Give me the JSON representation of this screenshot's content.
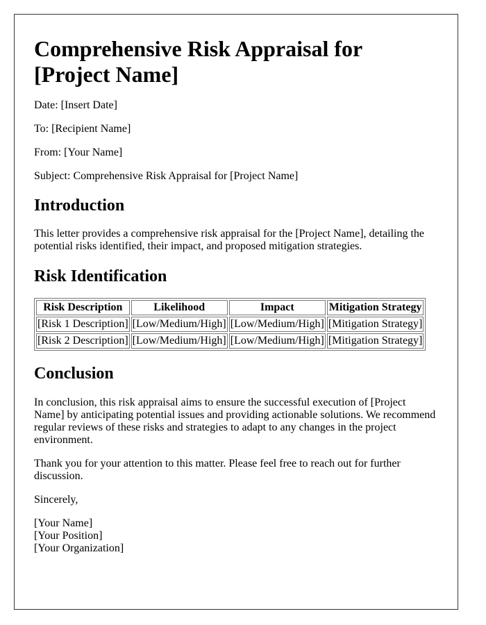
{
  "letter": {
    "title": "Comprehensive Risk Appraisal for [Project Name]",
    "meta": {
      "date": "Date: [Insert Date]",
      "to": "To: [Recipient Name]",
      "from": "From: [Your Name]",
      "subject": "Subject: Comprehensive Risk Appraisal for [Project Name]"
    },
    "introduction": {
      "heading": "Introduction",
      "text": "This letter provides a comprehensive risk appraisal for the [Project Name], detailing the potential risks identified, their impact, and proposed mitigation strategies."
    },
    "risk_identification": {
      "heading": "Risk Identification",
      "table": {
        "headers": [
          "Risk Description",
          "Likelihood",
          "Impact",
          "Mitigation Strategy"
        ],
        "rows": [
          [
            "[Risk 1 Description]",
            "[Low/Medium/High]",
            "[Low/Medium/High]",
            "[Mitigation Strategy]"
          ],
          [
            "[Risk 2 Description]",
            "[Low/Medium/High]",
            "[Low/Medium/High]",
            "[Mitigation Strategy]"
          ]
        ]
      }
    },
    "conclusion": {
      "heading": "Conclusion",
      "text": "In conclusion, this risk appraisal aims to ensure the successful execution of [Project Name] by anticipating potential issues and providing actionable solutions. We recommend regular reviews of these risks and strategies to adapt to any changes in the project environment.",
      "thanks": "Thank you for your attention to this matter. Please feel free to reach out for further discussion."
    },
    "closing": "Sincerely,",
    "signature": {
      "name": "[Your Name]",
      "position": "[Your Position]",
      "organization": "[Your Organization]"
    }
  }
}
